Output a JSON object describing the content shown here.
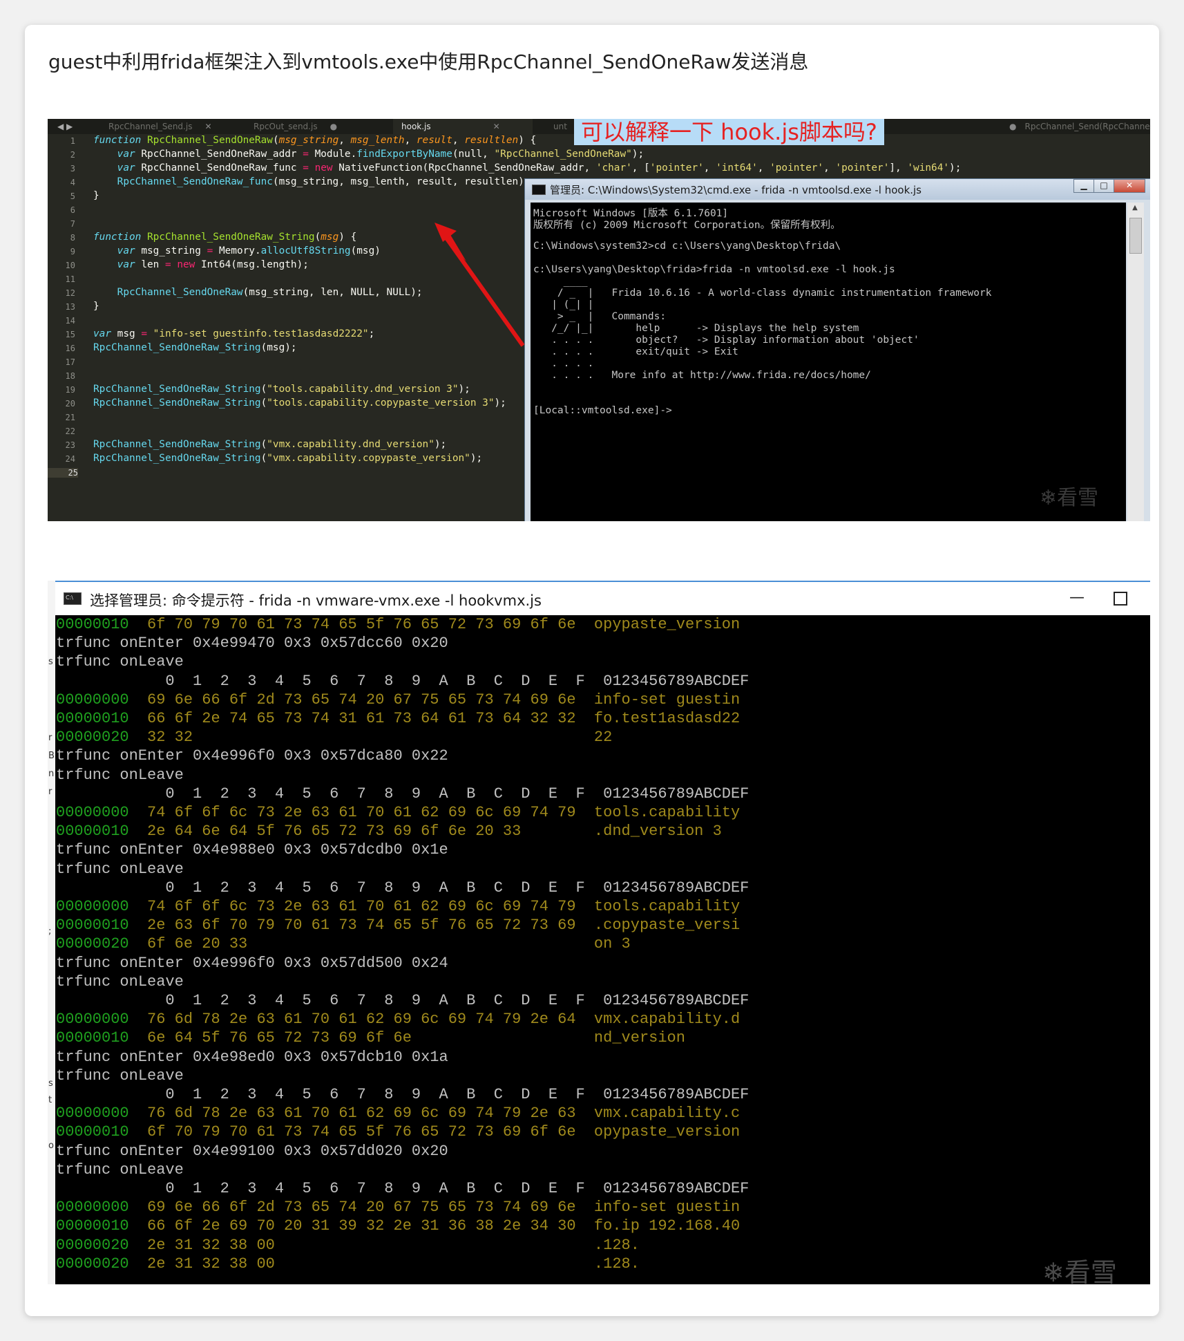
{
  "caption": "guest中利用frida框架注入到vmtools.exe中使用RpcChannel_SendOneRaw发送消息",
  "editor": {
    "nav_arrows": "◀ ▶",
    "tabs": [
      {
        "label": "RpcChannel_Send.js"
      },
      {
        "label": "RpcOut_send.js"
      },
      {
        "label": "hook.js"
      },
      {
        "label": "unt"
      },
      {
        "label": "RpcChannel_Send(RpcChannel"
      }
    ],
    "annotation_question": "可以解释一下 hook.js脚本吗?",
    "line_numbers": [
      "1",
      "2",
      "3",
      "4",
      "5",
      "6",
      "7",
      "8",
      "9",
      "10",
      "11",
      "12",
      "13",
      "14",
      "15",
      "16",
      "17",
      "18",
      "19",
      "20",
      "21",
      "22",
      "23",
      "24",
      "25"
    ],
    "code": {
      "l1": {
        "kw": "function",
        "fn": "RpcChannel_SendOneRaw",
        "open": "(",
        "p1": "msg_string",
        "c1": ", ",
        "p2": "msg_lenth",
        "c2": ", ",
        "p3": "result",
        "c3": ", ",
        "p4": "resultlen",
        "close": ") {"
      },
      "l2": {
        "kw": "var",
        "name": " RpcChannel_SendOneRaw_addr ",
        "eq": "=",
        "mod": " Module.",
        "call": "findExportByName",
        "args": "(null, ",
        "str": "\"RpcChannel_SendOneRaw\"",
        "end": ");"
      },
      "l3": {
        "kw": "var",
        "name": " RpcChannel_SendOneRaw_func ",
        "eq": "=",
        "new": " new",
        "call": " NativeFunction",
        "args": "(RpcChannel_SendOneRaw_addr, ",
        "s1": "'char'",
        "a2": ", [",
        "s2": "'pointer'",
        "a3": ", ",
        "s3": "'int64'",
        "a4": ", ",
        "s4": "'pointer'",
        "a5": ", ",
        "s5": "'pointer'",
        "a6": "], ",
        "s6": "'win64'",
        "end": ");"
      },
      "l4": {
        "call": "RpcChannel_SendOneRaw_func",
        "rest": "(msg_string, msg_lenth, result, resultlen);"
      },
      "l5": "}",
      "l8": {
        "kw": "function",
        "fn": "RpcChannel_SendOneRaw_String",
        "open": "(",
        "p1": "msg",
        "close": ") {"
      },
      "l9": {
        "kw": "var",
        "name": " msg_string ",
        "eq": "=",
        "mod": " Memory.",
        "call": "allocUtf8String",
        "rest": "(msg)"
      },
      "l10": {
        "kw": "var",
        "name": " len ",
        "eq": "=",
        "new": " new",
        "rest": " Int64(msg.length);"
      },
      "l12": {
        "call": "RpcChannel_SendOneRaw",
        "rest": "(msg_string, len, NULL, NULL);"
      },
      "l13": "}",
      "l15": {
        "kw": "var",
        "name": " msg ",
        "eq": "=",
        "str": " \"info-set guestinfo.test1asdasd2222\"",
        "end": ";"
      },
      "l16": {
        "call": "RpcChannel_SendOneRaw_String",
        "rest": "(msg);"
      },
      "l19": {
        "call": "RpcChannel_SendOneRaw_String",
        "open": "(",
        "str": "\"tools.capability.dnd_version 3\"",
        "end": ");"
      },
      "l20": {
        "call": "RpcChannel_SendOneRaw_String",
        "open": "(",
        "str": "\"tools.capability.copypaste_version 3\"",
        "end": ");"
      },
      "l23": {
        "call": "RpcChannel_SendOneRaw_String",
        "open": "(",
        "str": "\"vmx.capability.dnd_version\"",
        "end": ");"
      },
      "l24": {
        "call": "RpcChannel_SendOneRaw_String",
        "open": "(",
        "str": "\"vmx.capability.copypaste_version\"",
        "end": ");"
      }
    }
  },
  "cmd1": {
    "title": "管理员: C:\\Windows\\System32\\cmd.exe - frida  -n vmtoolsd.exe -l hook.js",
    "buttons": {
      "minimize": "▁",
      "maximize": "□",
      "close": "✕"
    },
    "lines": [
      "Microsoft Windows [版本 6.1.7601]",
      "版权所有 (c) 2009 Microsoft Corporation。保留所有权利。",
      "",
      "C:\\Windows\\system32>cd c:\\Users\\yang\\Desktop\\frida\\",
      "",
      "c:\\Users\\yang\\Desktop\\frida>frida -n vmtoolsd.exe -l hook.js",
      "     ____",
      "    / _  |   Frida 10.6.16 - A world-class dynamic instrumentation framework",
      "   | (_| |",
      "    > _  |   Commands:",
      "   /_/ |_|       help      -> Displays the help system",
      "   . . . .       object?   -> Display information about 'object'",
      "   . . . .       exit/quit -> Exit",
      "   . . . .",
      "   . . . .   More info at http://www.frida.re/docs/home/",
      "",
      "",
      "[Local::vmtoolsd.exe]->"
    ],
    "watermark": "❄看雪"
  },
  "cmd2": {
    "title": "选择管理员: 命令提示符 - frida  -n vmware-vmx.exe -l hookvmx.js",
    "buttons": {
      "minimize": "—",
      "maximize": ""
    },
    "left_strip": [
      "s",
      "r",
      "B",
      "n",
      "r",
      ";",
      "s",
      "t",
      "o"
    ],
    "lines": [
      {
        "a": "00000010",
        "b": "  6f 70 79 70 61 73 74 65 5f 76 65 72 73 69 6f 6e",
        "c": "  opypaste_version"
      },
      {
        "t": "trfunc onEnter 0x4e99470 0x3 0x57dcc60 0x20"
      },
      {
        "t": "trfunc onLeave"
      },
      {
        "t": "            0  1  2  3  4  5  6  7  8  9  A  B  C  D  E  F  0123456789ABCDEF"
      },
      {
        "a": "00000000",
        "b": "  69 6e 66 6f 2d 73 65 74 20 67 75 65 73 74 69 6e",
        "c": "  info-set guestin"
      },
      {
        "a": "00000010",
        "b": "  66 6f 2e 74 65 73 74 31 61 73 64 61 73 64 32 32",
        "c": "  fo.test1asdasd22"
      },
      {
        "a": "00000020",
        "b": "  32 32                                          ",
        "c": "  22"
      },
      {
        "t": "trfunc onEnter 0x4e996f0 0x3 0x57dca80 0x22"
      },
      {
        "t": "trfunc onLeave"
      },
      {
        "t": "            0  1  2  3  4  5  6  7  8  9  A  B  C  D  E  F  0123456789ABCDEF"
      },
      {
        "a": "00000000",
        "b": "  74 6f 6f 6c 73 2e 63 61 70 61 62 69 6c 69 74 79",
        "c": "  tools.capability"
      },
      {
        "a": "00000010",
        "b": "  2e 64 6e 64 5f 76 65 72 73 69 6f 6e 20 33      ",
        "c": "  .dnd_version 3"
      },
      {
        "t": "trfunc onEnter 0x4e988e0 0x3 0x57dcdb0 0x1e"
      },
      {
        "t": "trfunc onLeave"
      },
      {
        "t": "            0  1  2  3  4  5  6  7  8  9  A  B  C  D  E  F  0123456789ABCDEF"
      },
      {
        "a": "00000000",
        "b": "  74 6f 6f 6c 73 2e 63 61 70 61 62 69 6c 69 74 79",
        "c": "  tools.capability"
      },
      {
        "a": "00000010",
        "b": "  2e 63 6f 70 79 70 61 73 74 65 5f 76 65 72 73 69",
        "c": "  .copypaste_versi"
      },
      {
        "a": "00000020",
        "b": "  6f 6e 20 33                                    ",
        "c": "  on 3"
      },
      {
        "t": "trfunc onEnter 0x4e996f0 0x3 0x57dd500 0x24"
      },
      {
        "t": "trfunc onLeave"
      },
      {
        "t": "            0  1  2  3  4  5  6  7  8  9  A  B  C  D  E  F  0123456789ABCDEF"
      },
      {
        "a": "00000000",
        "b": "  76 6d 78 2e 63 61 70 61 62 69 6c 69 74 79 2e 64",
        "c": "  vmx.capability.d"
      },
      {
        "a": "00000010",
        "b": "  6e 64 5f 76 65 72 73 69 6f 6e                  ",
        "c": "  nd_version"
      },
      {
        "t": "trfunc onEnter 0x4e98ed0 0x3 0x57dcb10 0x1a"
      },
      {
        "t": "trfunc onLeave"
      },
      {
        "t": "            0  1  2  3  4  5  6  7  8  9  A  B  C  D  E  F  0123456789ABCDEF"
      },
      {
        "a": "00000000",
        "b": "  76 6d 78 2e 63 61 70 61 62 69 6c 69 74 79 2e 63",
        "c": "  vmx.capability.c"
      },
      {
        "a": "00000010",
        "b": "  6f 70 79 70 61 73 74 65 5f 76 65 72 73 69 6f 6e",
        "c": "  opypaste_version"
      },
      {
        "t": "trfunc onEnter 0x4e99100 0x3 0x57dd020 0x20"
      },
      {
        "t": "trfunc onLeave"
      },
      {
        "t": "            0  1  2  3  4  5  6  7  8  9  A  B  C  D  E  F  0123456789ABCDEF"
      },
      {
        "a": "00000000",
        "b": "  69 6e 66 6f 2d 73 65 74 20 67 75 65 73 74 69 6e",
        "c": "  info-set guestin"
      },
      {
        "a": "00000010",
        "b": "  66 6f 2e 69 70 20 31 39 32 2e 31 36 38 2e 34 30",
        "c": "  fo.ip 192.168.40"
      },
      {
        "a": "00000020",
        "b": "  2e 31 32 38 00                                 ",
        "c": "  .128."
      },
      {
        "a": "00000020",
        "b": "  2e 31 32 38 00                                 ",
        "c": "  .128."
      }
    ],
    "watermark": "❄看雪"
  }
}
